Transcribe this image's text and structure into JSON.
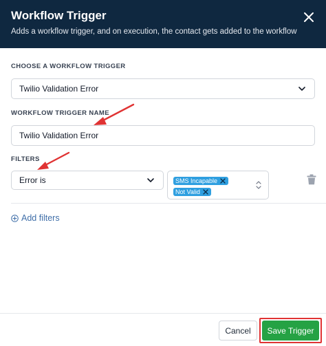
{
  "dialog": {
    "title": "Workflow Trigger",
    "subtitle": "Adds a workflow trigger, and on execution, the contact gets added to the workflow",
    "close_icon": "close-icon"
  },
  "workflow_trigger": {
    "label": "CHOOSE A WORKFLOW TRIGGER",
    "selected": "Twilio Validation Error"
  },
  "trigger_name": {
    "label": "WORKFLOW TRIGGER NAME",
    "value": "Twilio Validation Error"
  },
  "filters": {
    "label": "FILTERS",
    "condition": "Error is",
    "values": [
      "SMS Incapable",
      "Not Valid"
    ],
    "add_label": "Add filters"
  },
  "footer": {
    "cancel_label": "Cancel",
    "save_label": "Save Trigger"
  },
  "colors": {
    "header_bg": "#0f2840",
    "chip": "#2f9fe0",
    "save": "#25a244",
    "annotation": "#e03333"
  }
}
